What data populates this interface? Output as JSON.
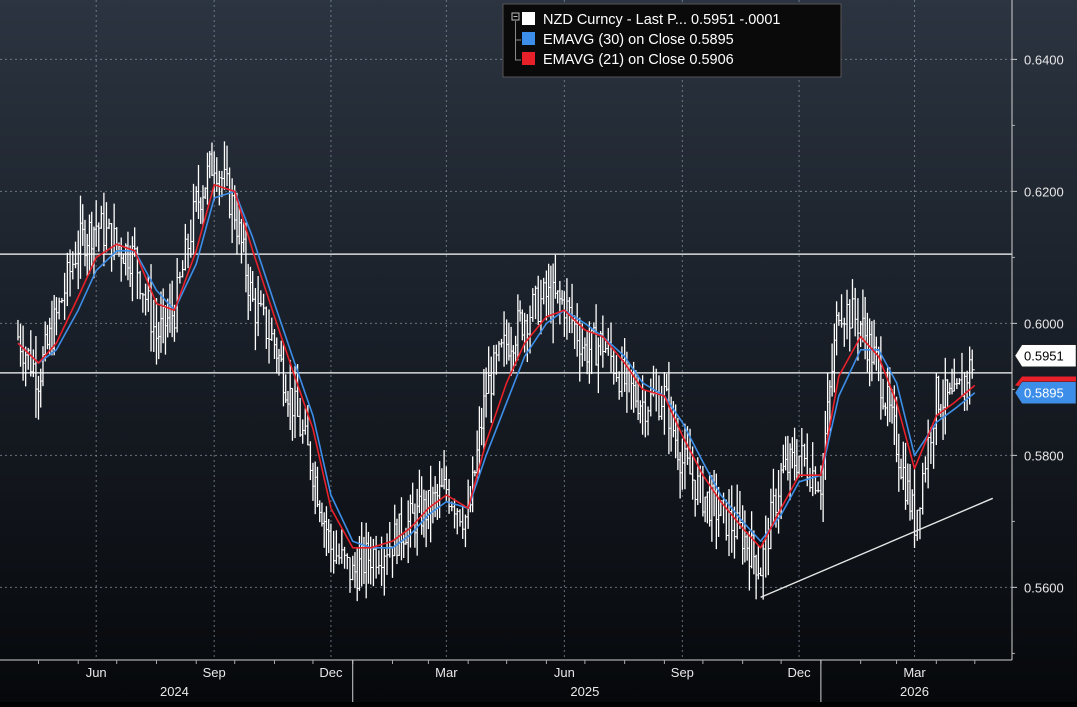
{
  "colors": {
    "price": "#ffffff",
    "ema30": "#3d8ee8",
    "ema21": "#e8202a",
    "grid": "#8a96a6",
    "axis_text": "#e8e8e8",
    "legend_bg": "#0a0a0a"
  },
  "legend": [
    {
      "swatch": "#ffffff",
      "text": "NZD Curncy - Last P... 0.5951  -.0001"
    },
    {
      "swatch": "#3d8ee8",
      "text": "EMAVG (30)  on Close  0.5895"
    },
    {
      "swatch": "#e8202a",
      "text": "EMAVG (21)  on Close  0.5906"
    }
  ],
  "price_tags": {
    "last": "0.5951",
    "ema30": "0.5895"
  },
  "chart_data": {
    "type": "line",
    "title": "",
    "xlabel": "",
    "ylabel": "",
    "ylim": [
      0.549,
      0.649
    ],
    "y_ticks": [
      "0.5600",
      "0.5800",
      "0.6000",
      "0.6200",
      "0.6400"
    ],
    "x_month_labels": [
      "Jun",
      "Sep",
      "Dec",
      "Mar",
      "Jun",
      "Sep",
      "Dec",
      "Mar"
    ],
    "x_year_labels": [
      "2024",
      "2025",
      "2026"
    ],
    "grid": true,
    "legend_position": "top-center",
    "x": [
      "2024-04-15",
      "2024-05-01",
      "2024-05-15",
      "2024-06-01",
      "2024-06-15",
      "2024-07-01",
      "2024-07-15",
      "2024-08-01",
      "2024-08-15",
      "2024-09-01",
      "2024-09-15",
      "2024-10-01",
      "2024-10-15",
      "2024-11-01",
      "2024-11-15",
      "2024-12-01",
      "2024-12-15",
      "2025-01-01",
      "2025-01-15",
      "2025-02-01",
      "2025-02-15",
      "2025-03-01",
      "2025-03-15",
      "2025-04-01",
      "2025-04-15",
      "2025-05-01",
      "2025-05-15",
      "2025-06-01",
      "2025-06-15",
      "2025-07-01",
      "2025-07-15",
      "2025-08-01",
      "2025-08-15",
      "2025-09-01",
      "2025-09-15",
      "2025-10-01",
      "2025-10-15",
      "2025-11-01",
      "2025-11-15",
      "2025-12-01",
      "2025-12-15",
      "2026-01-01",
      "2026-01-15",
      "2026-02-01",
      "2026-02-15",
      "2026-03-01",
      "2026-03-15",
      "2026-04-01",
      "2026-04-15",
      "2026-05-01"
    ],
    "series": [
      {
        "name": "NZD Curncy - Last Price",
        "color": "#ffffff",
        "values": [
          0.598,
          0.592,
          0.601,
          0.612,
          0.615,
          0.612,
          0.61,
          0.598,
          0.602,
          0.618,
          0.625,
          0.617,
          0.603,
          0.597,
          0.588,
          0.578,
          0.566,
          0.562,
          0.565,
          0.567,
          0.57,
          0.572,
          0.575,
          0.57,
          0.59,
          0.597,
          0.601,
          0.604,
          0.603,
          0.596,
          0.597,
          0.591,
          0.588,
          0.589,
          0.579,
          0.574,
          0.571,
          0.568,
          0.563,
          0.577,
          0.58,
          0.576,
          0.603,
          0.6,
          0.593,
          0.582,
          0.57,
          0.589,
          0.588,
          0.595
        ]
      },
      {
        "name": "EMAVG (30) on Close",
        "color": "#3d8ee8",
        "values": [
          0.597,
          0.594,
          0.596,
          0.602,
          0.608,
          0.611,
          0.611,
          0.605,
          0.602,
          0.609,
          0.619,
          0.62,
          0.613,
          0.603,
          0.595,
          0.586,
          0.574,
          0.567,
          0.566,
          0.566,
          0.568,
          0.571,
          0.573,
          0.572,
          0.58,
          0.588,
          0.595,
          0.6,
          0.602,
          0.6,
          0.598,
          0.595,
          0.591,
          0.589,
          0.585,
          0.579,
          0.574,
          0.57,
          0.567,
          0.571,
          0.576,
          0.577,
          0.589,
          0.596,
          0.596,
          0.591,
          0.58,
          0.585,
          0.587,
          0.5895
        ]
      },
      {
        "name": "EMAVG (21) on Close",
        "color": "#e8202a",
        "values": [
          0.597,
          0.594,
          0.597,
          0.604,
          0.61,
          0.612,
          0.611,
          0.603,
          0.602,
          0.611,
          0.621,
          0.62,
          0.611,
          0.601,
          0.593,
          0.584,
          0.572,
          0.566,
          0.566,
          0.567,
          0.569,
          0.572,
          0.574,
          0.572,
          0.582,
          0.591,
          0.597,
          0.601,
          0.602,
          0.599,
          0.598,
          0.594,
          0.59,
          0.589,
          0.583,
          0.577,
          0.573,
          0.569,
          0.566,
          0.572,
          0.577,
          0.577,
          0.592,
          0.598,
          0.595,
          0.588,
          0.578,
          0.586,
          0.588,
          0.5906
        ]
      }
    ],
    "support_line": {
      "from": {
        "x": "2025-11-15",
        "y": 0.5585
      },
      "to": {
        "x": "2026-05-15",
        "y": 0.5735
      }
    },
    "horizontal_lines": [
      0.6105,
      0.5925
    ]
  }
}
